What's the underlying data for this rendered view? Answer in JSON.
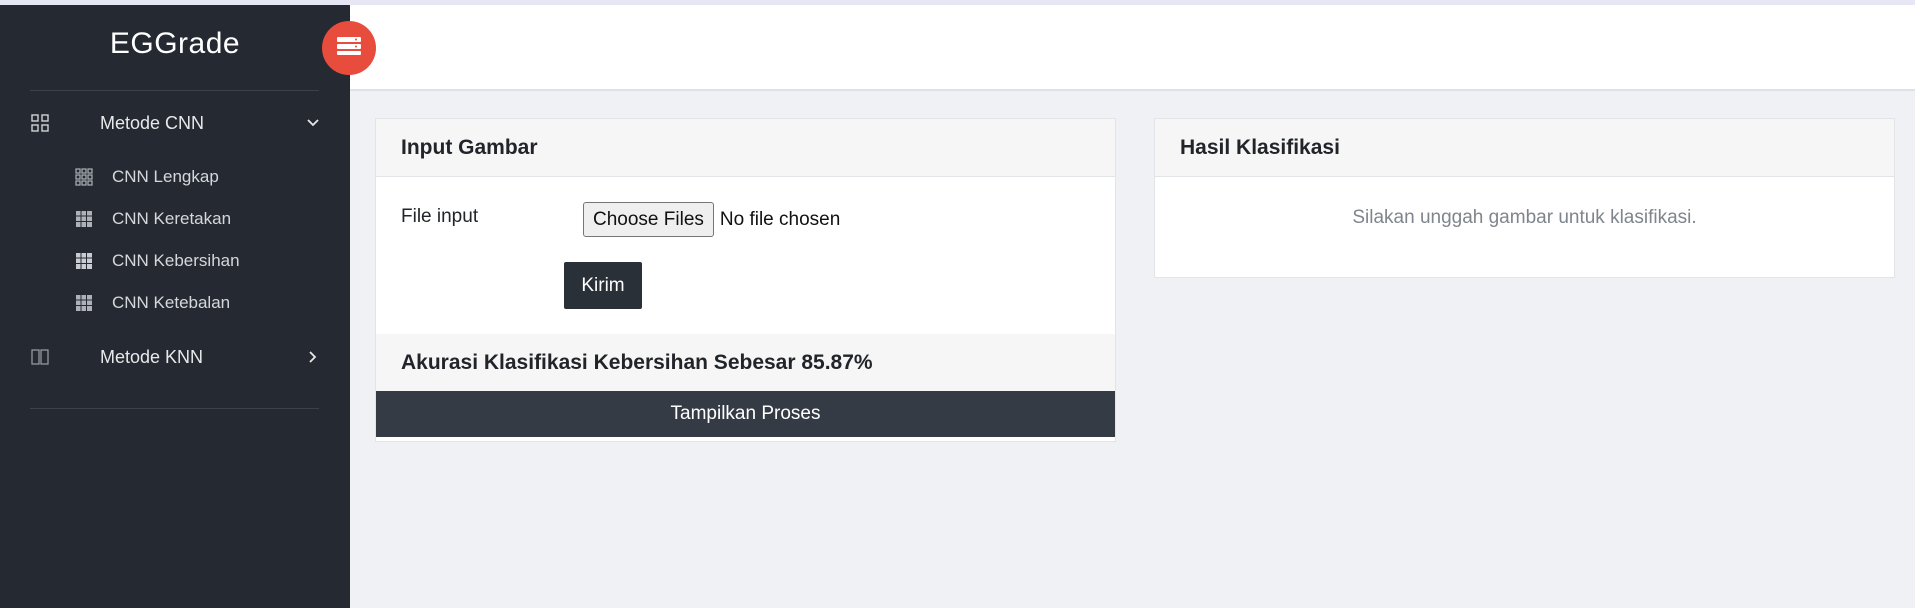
{
  "app": {
    "brand": "EGGrade"
  },
  "sidebar": {
    "menus": [
      {
        "label": "Metode CNN",
        "icon": "grid-icon",
        "expanded": true
      },
      {
        "label": "Metode KNN",
        "icon": "columns-icon",
        "expanded": false
      }
    ],
    "cnn_items": [
      {
        "label": "CNN Lengkap"
      },
      {
        "label": "CNN Keretakan"
      },
      {
        "label": "CNN Kebersihan"
      },
      {
        "label": "CNN Ketebalan"
      }
    ]
  },
  "input_card": {
    "title": "Input Gambar",
    "file_label": "File input",
    "choose_files": "Choose Files",
    "no_file": "No file chosen",
    "submit": "Kirim",
    "accuracy": "Akurasi Klasifikasi Kebersihan Sebesar 85.87%",
    "show_process": "Tampilkan Proses"
  },
  "result_card": {
    "title": "Hasil Klasifikasi",
    "hint": "Silakan unggah gambar untuk klasifikasi."
  },
  "colors": {
    "sidebar_bg": "#252a32",
    "accent_toggle": "#e74c3c",
    "button_dark": "#2a3038"
  }
}
